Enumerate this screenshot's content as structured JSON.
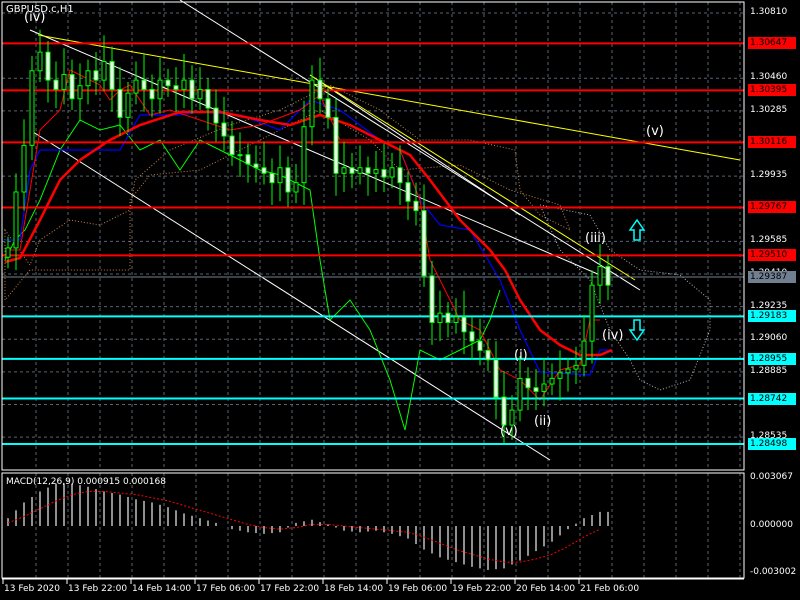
{
  "symbol_title": "GBPUSD.c,H1",
  "macd_title": "MACD(12,26,9) 0.000915 0.000168",
  "colors": {
    "bull": "#00ff00",
    "resistance": "#ff0000",
    "support": "#00ffff",
    "ma_fast": "#0000ff",
    "ma_slow": "#ff0000",
    "trend": "#ffff00",
    "current": "#708090"
  },
  "price_ticks": [
    "1.30810",
    "1.30460",
    "1.30285",
    "1.29935",
    "1.29585",
    "1.29410",
    "1.29235",
    "1.29060",
    "1.28885",
    "1.28710",
    "1.28535"
  ],
  "resistance_levels": [
    "1.30647",
    "1.30395",
    "1.30116",
    "1.29767",
    "1.29510"
  ],
  "support_levels": [
    "1.29183",
    "1.28955",
    "1.28742",
    "1.28498"
  ],
  "current_price": "1.29387",
  "macd_ticks": [
    "0.003067",
    "0.000000",
    "-0.003002"
  ],
  "time_labels": [
    "13 Feb 2020",
    "13 Feb 22:00",
    "14 Feb 14:00",
    "17 Feb 06:00",
    "17 Feb 22:00",
    "18 Feb 14:00",
    "19 Feb 06:00",
    "19 Feb 22:00",
    "20 Feb 14:00",
    "21 Feb 06:00"
  ],
  "wave_labels": {
    "iv_top": "(iv)",
    "v_target": "(v)",
    "iii": "(iii)",
    "iv": "(iv)",
    "i": "(i)",
    "ii": "(ii)",
    "v_low": "(v)"
  },
  "chart_data": {
    "type": "candlestick",
    "title": "GBPUSD.c,H1",
    "ylim": [
      1.2845,
      1.3085
    ],
    "closes": [
      1.2955,
      1.2985,
      1.301,
      1.305,
      1.306,
      1.3045,
      1.304,
      1.3048,
      1.3035,
      1.3042,
      1.305,
      1.3045,
      1.3055,
      1.304,
      1.3025,
      1.3038,
      1.3045,
      1.304,
      1.3035,
      1.3045,
      1.3042,
      1.304,
      1.3045,
      1.3035,
      1.304,
      1.303,
      1.3022,
      1.3015,
      1.3005,
      1.3005,
      1.3,
      1.2998,
      1.2995,
      1.299,
      1.2998,
      1.2985,
      1.299,
      1.302,
      1.3045,
      1.3035,
      1.3025,
      1.2995,
      1.2998,
      1.2995,
      1.2998,
      1.2995,
      1.2997,
      1.2993,
      1.2998,
      1.299,
      1.298,
      1.2975,
      1.294,
      1.2915,
      1.292,
      1.2915,
      1.2918,
      1.291,
      1.2905,
      1.29,
      1.2895,
      1.2875,
      1.286,
      1.2868,
      1.2885,
      1.288,
      1.2878,
      1.2882,
      1.2885,
      1.2888,
      1.289,
      1.2892,
      1.2905,
      1.2935,
      1.2945,
      1.2935
    ],
    "macd": {
      "ylim": [
        -0.003002,
        0.003067
      ],
      "histogram": [
        0.0005,
        0.0015,
        0.0022,
        0.0027,
        0.0027,
        0.0025,
        0.0022,
        0.002,
        0.0017,
        0.0015,
        0.0012,
        0.0008,
        0.0005,
        0.0002,
        -0.0002,
        -0.0004,
        -0.0005,
        -0.0004,
        0.0002,
        0.0004,
        0.0001,
        -0.0003,
        -0.0004,
        -0.0003,
        -0.0005,
        -0.0008,
        -0.0015,
        -0.002,
        -0.0023,
        -0.0026,
        -0.0028,
        -0.0027,
        -0.0022,
        -0.0016,
        -0.001,
        -0.0002,
        0.0005,
        0.0009
      ],
      "signal": [
        0.0002,
        0.0006,
        0.0011,
        0.0016,
        0.002,
        0.0022,
        0.0022,
        0.0021,
        0.002,
        0.0018,
        0.0016,
        0.0013,
        0.001,
        0.0007,
        0.0004,
        0.0001,
        -0.0001,
        -0.0002,
        -0.0001,
        0.0001,
        0.0001,
        0.0,
        -0.0001,
        -0.0002,
        -0.0003,
        -0.0004,
        -0.0007,
        -0.0011,
        -0.0015,
        -0.0018,
        -0.0021,
        -0.0023,
        -0.0023,
        -0.0021,
        -0.0018,
        -0.0013,
        -0.0007,
        -0.0002
      ]
    }
  }
}
